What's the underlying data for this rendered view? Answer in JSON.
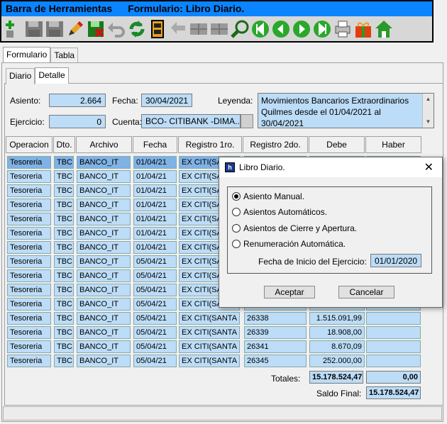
{
  "toolbar": {
    "title": "Barra de Herramientas",
    "subtitle": "Formulario: Libro Diario.",
    "icons": [
      "add-icon",
      "save-icon",
      "save-as-icon",
      "edit-icon",
      "delete-icon",
      "undo-icon",
      "refresh-icon",
      "film-icon",
      "back-arrow-icon",
      "grid-icon",
      "grid-icon",
      "search-icon",
      "first-record-icon",
      "previous-record-icon",
      "next-record-icon",
      "last-record-icon",
      "print-icon",
      "gift-icon",
      "home-icon"
    ]
  },
  "outer_tabs": [
    "Formulario",
    "Tabla"
  ],
  "inner_tabs": [
    "Diario",
    "Detalle"
  ],
  "form": {
    "asiento_label": "Asiento:",
    "asiento_value": "2.664",
    "fecha_label": "Fecha:",
    "fecha_value": "30/04/2021",
    "leyenda_label": "Leyenda:",
    "leyenda_value": "Movimientos Bancarios Extraordinarios Quilmes desde el 01/04/2021 al 30/04/2021",
    "ejercicio_label": "Ejercicio:",
    "ejercicio_value": "0",
    "cuenta_label": "Cuenta:",
    "cuenta_value": "BCO- CITIBANK -DIMA..."
  },
  "grid": {
    "headers": [
      "Operacion",
      "Dto.",
      "Archivo",
      "Fecha",
      "Registro 1ro.",
      "Registro 2do.",
      "Debe",
      "Haber"
    ],
    "rows": [
      [
        "Tesoreria",
        "TBC",
        "BANCO_IT",
        "01/04/21",
        "EX CITI(SA",
        "",
        "",
        ""
      ],
      [
        "Tesoreria",
        "TBC",
        "BANCO_IT",
        "01/04/21",
        "EX CITI(SA",
        "",
        "",
        ""
      ],
      [
        "Tesoreria",
        "TBC",
        "BANCO_IT",
        "01/04/21",
        "EX CITI(SA",
        "",
        "",
        ""
      ],
      [
        "Tesoreria",
        "TBC",
        "BANCO_IT",
        "01/04/21",
        "EX CITI(SA",
        "",
        "",
        ""
      ],
      [
        "Tesoreria",
        "TBC",
        "BANCO_IT",
        "01/04/21",
        "EX CITI(SA",
        "",
        "",
        ""
      ],
      [
        "Tesoreria",
        "TBC",
        "BANCO_IT",
        "01/04/21",
        "EX CITI(SA",
        "",
        "",
        ""
      ],
      [
        "Tesoreria",
        "TBC",
        "BANCO_IT",
        "01/04/21",
        "EX CITI(SA",
        "",
        "",
        ""
      ],
      [
        "Tesoreria",
        "TBC",
        "BANCO_IT",
        "05/04/21",
        "EX CITI(SA",
        "",
        "",
        ""
      ],
      [
        "Tesoreria",
        "TBC",
        "BANCO_IT",
        "05/04/21",
        "EX CITI(SA",
        "",
        "",
        ""
      ],
      [
        "Tesoreria",
        "TBC",
        "BANCO_IT",
        "05/04/21",
        "EX CITI(SA",
        "",
        "",
        ""
      ],
      [
        "Tesoreria",
        "TBC",
        "BANCO_IT",
        "05/04/21",
        "EX CITI(SA",
        "",
        "",
        ""
      ],
      [
        "Tesoreria",
        "TBC",
        "BANCO_IT",
        "05/04/21",
        "EX CITI(SANTA",
        "26338",
        "1.515.091,99",
        ""
      ],
      [
        "Tesoreria",
        "TBC",
        "BANCO_IT",
        "05/04/21",
        "EX CITI(SANTA",
        "26339",
        "18.908,00",
        ""
      ],
      [
        "Tesoreria",
        "TBC",
        "BANCO_IT",
        "05/04/21",
        "EX CITI(SANTA",
        "26341",
        "8.670,09",
        ""
      ],
      [
        "Tesoreria",
        "TBC",
        "BANCO_IT",
        "05/04/21",
        "EX CITI(SANTA",
        "26345",
        "252.000,00",
        ""
      ]
    ]
  },
  "totals": {
    "totales_label": "Totales:",
    "debe_total": "15.178.524,47",
    "haber_total": "0,00",
    "saldo_label": "Saldo Final:",
    "saldo_value": "15.178.524,47"
  },
  "dialog": {
    "title": "Libro Diario.",
    "close": "✕",
    "options": [
      "Asiento Manual.",
      "Asientos Automáticos.",
      "Asientos de Cierre y Apertura.",
      "Renumeración Automática."
    ],
    "selected_index": 0,
    "fecha_inicio_label": "Fecha de Inicio del Ejercicio:",
    "fecha_inicio_value": "01/01/2020",
    "accept_label": "Aceptar",
    "cancel_label": "Cancelar"
  }
}
